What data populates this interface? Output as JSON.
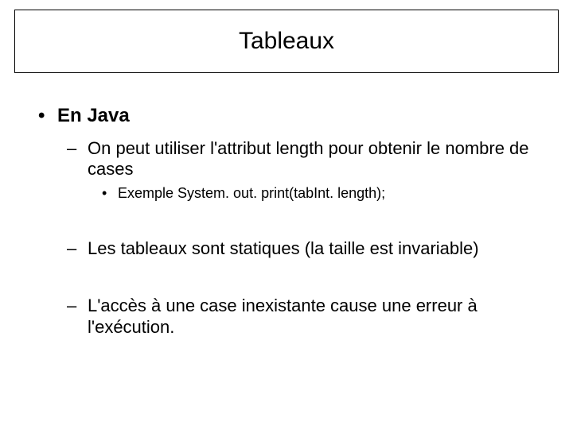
{
  "title": "Tableaux",
  "lvl1": {
    "bullet": "•",
    "text": "En Java"
  },
  "items": [
    {
      "dash": "–",
      "text": "On peut utiliser l'attribut length pour obtenir le nombre de cases"
    },
    {
      "dash": "–",
      "text": "Les tableaux sont statiques (la taille est invariable)"
    },
    {
      "dash": "–",
      "text": "L'accès à une case inexistante cause une erreur à l'exécution."
    }
  ],
  "subitem": {
    "dot": "•",
    "text": "Exemple System. out. print(tabInt. length);"
  }
}
